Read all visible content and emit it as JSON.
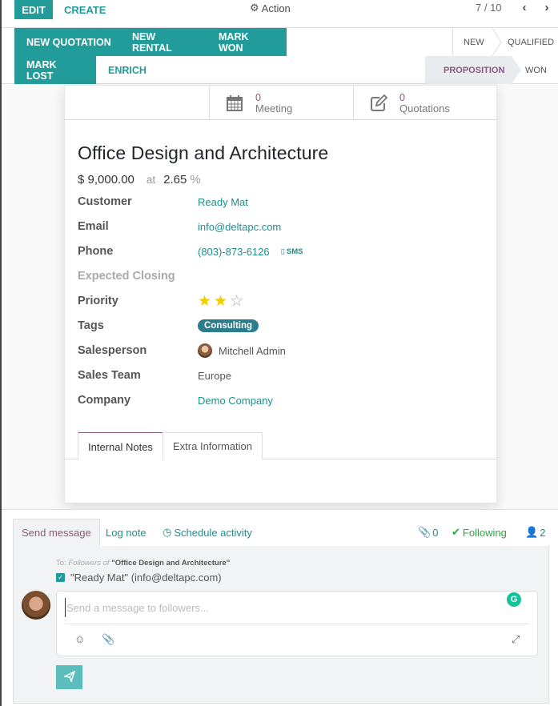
{
  "control_panel": {
    "edit_label": "EDIT",
    "create_label": "CREATE",
    "action_label": "Action",
    "pager_value": "7 / 10"
  },
  "header": {
    "buttons": [
      "NEW QUOTATION",
      "NEW RENTAL",
      "MARK WON",
      "MARK LOST"
    ],
    "enrich_label": "ENRICH",
    "stages": [
      "NEW",
      "QUALIFIED",
      "PROPOSITION",
      "WON"
    ],
    "active_stage": "PROPOSITION"
  },
  "smart_buttons": [
    {
      "count": "0",
      "label": "Meeting",
      "icon": "calendar-icon"
    },
    {
      "count": "0",
      "label": "Quotations",
      "icon": "pencil-square-icon"
    }
  ],
  "record": {
    "title": "Office Design and Architecture",
    "expected_revenue": "$ 9,000.00",
    "at_label": "at",
    "probability": "2.65",
    "percent_sign": "%",
    "fields": {
      "customer": {
        "label": "Customer",
        "value": "Ready Mat"
      },
      "email": {
        "label": "Email",
        "value": "info@deltapc.com"
      },
      "phone": {
        "label": "Phone",
        "value": "(803)-873-6126",
        "sms_label": "SMS"
      },
      "expected_closing": {
        "label": "Expected Closing",
        "value": ""
      },
      "priority": {
        "label": "Priority",
        "value": 2,
        "max": 3
      },
      "tags": {
        "label": "Tags",
        "value": "Consulting"
      },
      "salesperson": {
        "label": "Salesperson",
        "value": "Mitchell Admin"
      },
      "sales_team": {
        "label": "Sales Team",
        "value": "Europe"
      },
      "company": {
        "label": "Company",
        "value": "Demo Company"
      }
    },
    "tabs": [
      "Internal Notes",
      "Extra Information"
    ],
    "active_tab": "Internal Notes"
  },
  "chatter": {
    "tabs": {
      "send_message": "Send message",
      "log_note": "Log note",
      "schedule_activity": "Schedule activity"
    },
    "attachments_count": "0",
    "following_label": "Following",
    "followers_count": "2",
    "to_prefix": "To:",
    "followers_of": "Followers of",
    "record_quoted": "\"Office Design and Architecture\"",
    "recipient": "\"Ready Mat\" (info@deltapc.com)",
    "recipient_checked": true,
    "message_placeholder": "Send a message to followers...",
    "message_value": ""
  },
  "colors": {
    "primary": "#229c9a",
    "link": "#1d8f8d",
    "accent": "#875a7b",
    "star": "#f3cc00",
    "tag": "#2c7d8b",
    "following": "#28a745"
  }
}
